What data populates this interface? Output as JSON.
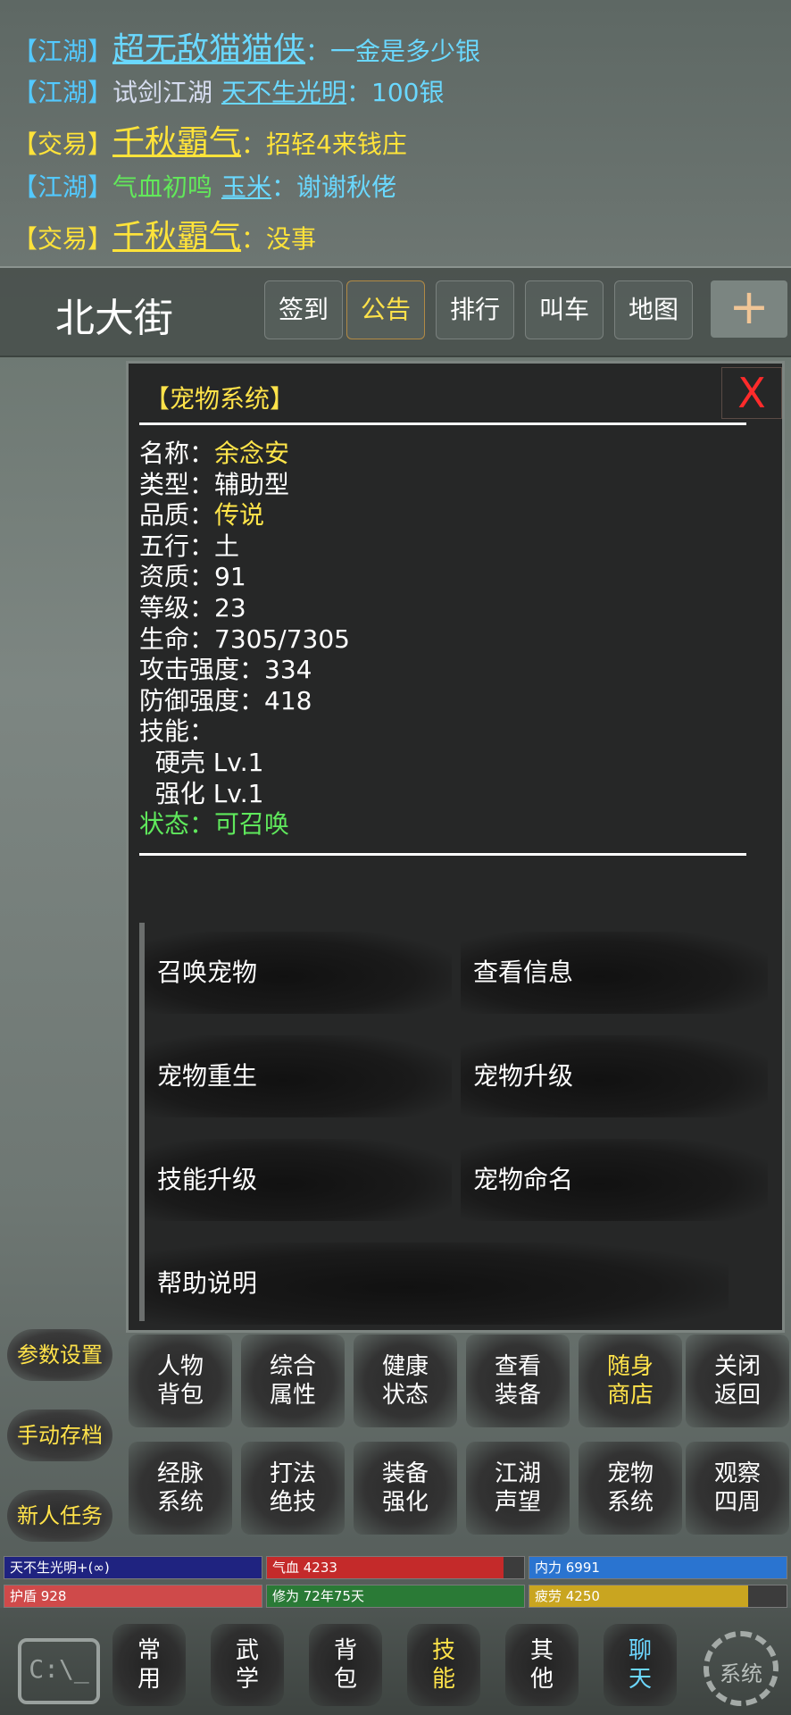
{
  "chat": [
    {
      "channel": "【江湖】",
      "channel_type": "jianghu",
      "title": "",
      "name": "超无敌猫猫侠",
      "name_size": "big",
      "message": "：一金是多少银"
    },
    {
      "channel": "【江湖】",
      "channel_type": "jianghu",
      "title": "试剑江湖",
      "name": "天不生光明",
      "name_size": "small",
      "message": "：100银"
    },
    {
      "channel": "【交易】",
      "channel_type": "trade",
      "title": "",
      "name": "千秋霸气",
      "name_size": "big",
      "message": "：招轻4来钱庄"
    },
    {
      "channel": "【江湖】",
      "channel_type": "jianghu",
      "title": "气血初鸣",
      "name": "玉米",
      "name_size": "small",
      "message": "：谢谢秋佬"
    },
    {
      "channel": "【交易】",
      "channel_type": "trade",
      "title": "",
      "name": "千秋霸气",
      "name_size": "big",
      "message": "：没事"
    }
  ],
  "location": {
    "title": "北大街"
  },
  "top_buttons": [
    {
      "label": "签到",
      "highlight": false
    },
    {
      "label": "公告",
      "highlight": true
    },
    {
      "label": "排行",
      "highlight": false
    },
    {
      "label": "叫车",
      "highlight": false
    },
    {
      "label": "地图",
      "highlight": false
    }
  ],
  "plus_label": "+",
  "pet": {
    "panel_title": "【宠物系统】",
    "close_label": "X",
    "rows": [
      {
        "label": "名称：",
        "value": "余念安",
        "style": "yellow"
      },
      {
        "label": "类型：",
        "value": "辅助型",
        "style": "white"
      },
      {
        "label": "品质：",
        "value": "传说",
        "style": "yellow"
      },
      {
        "label": "五行：",
        "value": "土",
        "style": "white"
      },
      {
        "label": "资质：",
        "value": "91",
        "style": "white"
      },
      {
        "label": "等级：",
        "value": "23",
        "style": "white"
      },
      {
        "label": "生命：",
        "value": "7305/7305",
        "style": "white"
      },
      {
        "label": "攻击强度：",
        "value": "334",
        "style": "white"
      },
      {
        "label": "防御强度：",
        "value": "418",
        "style": "white"
      },
      {
        "label": "技能：",
        "value": "",
        "style": "white"
      },
      {
        "label": "  硬壳 Lv.1",
        "value": "",
        "style": "white"
      },
      {
        "label": "  强化 Lv.1",
        "value": "",
        "style": "white"
      },
      {
        "label": "状态：",
        "value": "可召唤",
        "style": "green"
      }
    ],
    "actions": [
      "召唤宠物",
      "查看信息",
      "宠物重生",
      "宠物升级",
      "技能升级",
      "宠物命名",
      "帮助说明"
    ]
  },
  "side_buttons": [
    "参数设置",
    "手动存档",
    "新人任务"
  ],
  "grid_row1": [
    {
      "l1": "人物",
      "l2": "背包",
      "highlight": false
    },
    {
      "l1": "综合",
      "l2": "属性",
      "highlight": false
    },
    {
      "l1": "健康",
      "l2": "状态",
      "highlight": false
    },
    {
      "l1": "查看",
      "l2": "装备",
      "highlight": false
    },
    {
      "l1": "随身",
      "l2": "商店",
      "highlight": true
    },
    {
      "l1": "关闭",
      "l2": "返回",
      "highlight": false
    }
  ],
  "grid_row2": [
    {
      "l1": "经脉",
      "l2": "系统",
      "highlight": false
    },
    {
      "l1": "打法",
      "l2": "绝技",
      "highlight": false
    },
    {
      "l1": "装备",
      "l2": "强化",
      "highlight": false
    },
    {
      "l1": "江湖",
      "l2": "声望",
      "highlight": false
    },
    {
      "l1": "宠物",
      "l2": "系统",
      "highlight": false
    },
    {
      "l1": "观察",
      "l2": "四周",
      "highlight": false
    }
  ],
  "status_bars": [
    {
      "text": "天不生光明+(∞)",
      "fill": 1.0,
      "color": "#1f2380"
    },
    {
      "text": "气血 4233",
      "fill": 0.92,
      "color": "#c42a2a"
    },
    {
      "text": "内力 6991",
      "fill": 1.0,
      "color": "#2a74d0"
    },
    {
      "text": "护盾 928",
      "fill": 1.0,
      "color": "#cf4a4a"
    },
    {
      "text": "修为 72年75天",
      "fill": 1.0,
      "color": "#2a7a36"
    },
    {
      "text": "疲劳 4250",
      "fill": 0.85,
      "color": "#c9a520"
    }
  ],
  "bottom_nav": [
    {
      "l1": "常",
      "l2": "用",
      "style": "white"
    },
    {
      "l1": "武",
      "l2": "学",
      "style": "white"
    },
    {
      "l1": "背",
      "l2": "包",
      "style": "white"
    },
    {
      "l1": "技",
      "l2": "能",
      "style": "yellow"
    },
    {
      "l1": "其",
      "l2": "他",
      "style": "white"
    },
    {
      "l1": "聊",
      "l2": "天",
      "style": "cyan"
    }
  ],
  "console_icon_label": "C:\\_",
  "gear_icon_label": "系统"
}
